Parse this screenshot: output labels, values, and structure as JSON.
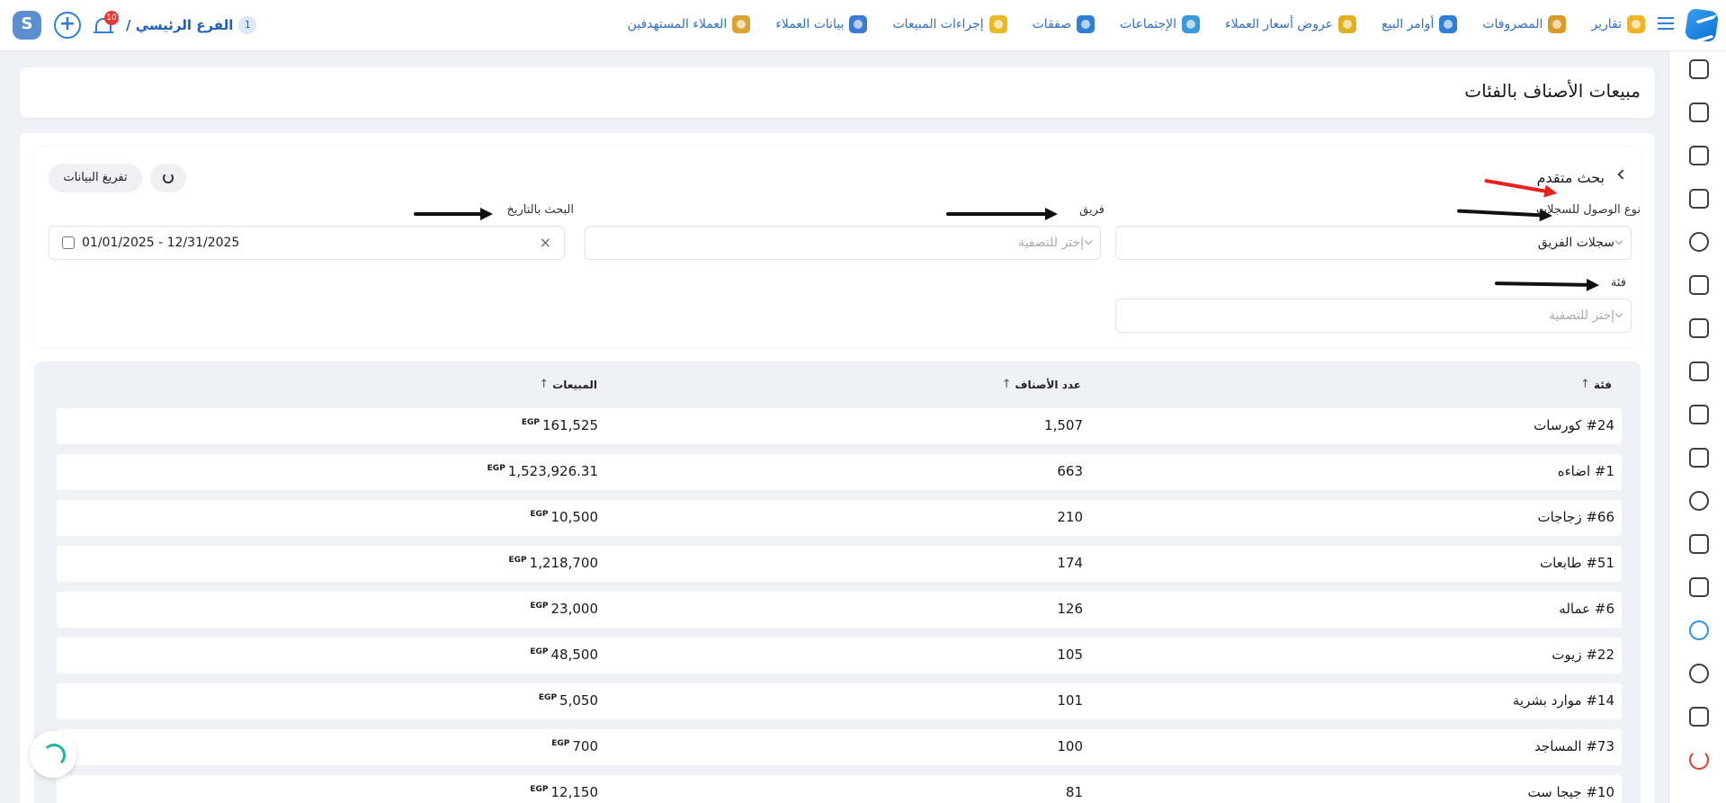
{
  "header": {
    "branch_name": "الفرع الرئيسي /",
    "branch_count": "1",
    "notifications_badge": "10",
    "nav": [
      {
        "label": "العملاء المستهدفين",
        "icon": "target-customers-icon",
        "color": "#d9a233"
      },
      {
        "label": "بيانات العملاء",
        "icon": "customer-data-icon",
        "color": "#3a7bd5"
      },
      {
        "label": "إجراءات المبيعات",
        "icon": "sales-actions-icon",
        "color": "#e8b923"
      },
      {
        "label": "صفقات",
        "icon": "deals-icon",
        "color": "#2f7fd8"
      },
      {
        "label": "الإجتماعات",
        "icon": "meetings-icon",
        "color": "#3a9ad9"
      },
      {
        "label": "عروض أسعار العملاء",
        "icon": "quotes-icon",
        "color": "#e0b020"
      },
      {
        "label": "أوامر البيع",
        "icon": "sales-orders-icon",
        "color": "#2f7fd8"
      },
      {
        "label": "المصروفات",
        "icon": "expenses-icon",
        "color": "#d99a2a"
      },
      {
        "label": "تقارير",
        "icon": "reports-icon",
        "color": "#f0b429"
      }
    ]
  },
  "page": {
    "title": "مبيعات الأصناف بالفئات"
  },
  "filters": {
    "advanced_search": "بحث متقدم",
    "clear_button": "تفريغ البيانات",
    "access_type_label": "نوع الوصول للسجلات",
    "access_type_value": "سجلات الفريق",
    "team_label": "فريق",
    "team_placeholder": "إختر للتصفية",
    "date_label": "البحث بالتاريخ",
    "date_value": "01/01/2025 - 12/31/2025",
    "category_label": "فئة",
    "category_placeholder": "إختر للتصفية"
  },
  "table": {
    "headers": {
      "category": "فئة",
      "count": "عدد الأصناف",
      "sales": "المبيعات"
    },
    "currency": "EGP",
    "rows": [
      {
        "category": "#24 كورسات",
        "count": "1,507",
        "sales": "161,525"
      },
      {
        "category": "#1 اضاءه",
        "count": "663",
        "sales": "1,523,926.31"
      },
      {
        "category": "#66 زجاجات",
        "count": "210",
        "sales": "10,500"
      },
      {
        "category": "#51 طابعات",
        "count": "174",
        "sales": "1,218,700"
      },
      {
        "category": "#6 عماله",
        "count": "126",
        "sales": "23,000"
      },
      {
        "category": "#22 زيوت",
        "count": "105",
        "sales": "48,500"
      },
      {
        "category": "#14 موارد بشرية",
        "count": "101",
        "sales": "5,050"
      },
      {
        "category": "#73 المساجد",
        "count": "100",
        "sales": "700"
      },
      {
        "category": "#10 جيجا ست",
        "count": "81",
        "sales": "12,150"
      }
    ]
  },
  "colors": {
    "accent": "#2f7fd8",
    "annotation_red": "#e8201e",
    "annotation_black": "#111111",
    "danger": "#e53935"
  }
}
